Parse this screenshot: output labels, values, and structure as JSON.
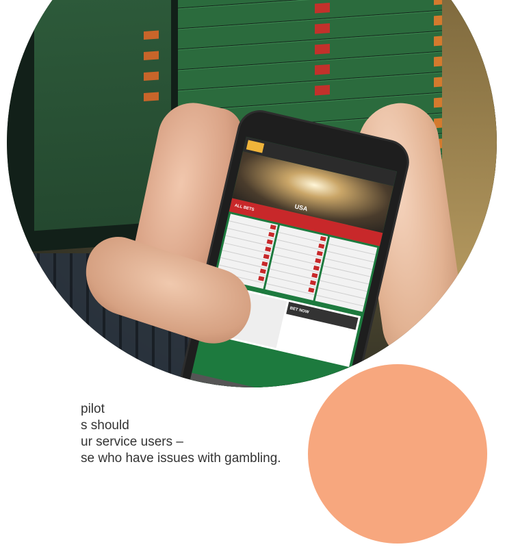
{
  "photo": {
    "phone_app": {
      "hero_badge": "USA",
      "table_header": "ALL BETS",
      "bet_panel_header": "BET NOW"
    }
  },
  "caption": {
    "lines": [
      "pilot",
      "s should",
      "ur service users –",
      "se who have issues with gambling."
    ]
  },
  "colors": {
    "accent_peach": "#f7a77e",
    "betting_green": "#1d7a3e",
    "betting_red": "#c8282a",
    "caption_text": "#333333"
  }
}
